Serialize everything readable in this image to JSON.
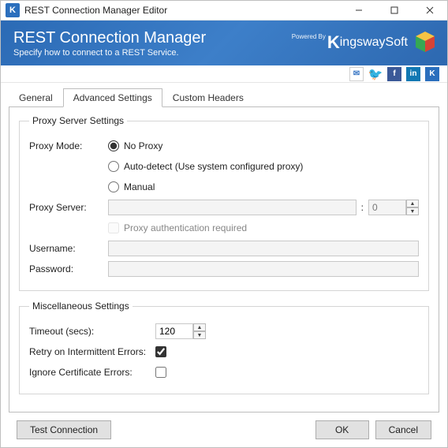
{
  "titlebar": {
    "title": "REST Connection Manager Editor"
  },
  "banner": {
    "heading": "REST Connection Manager",
    "sub": "Specify how to connect to a REST Service.",
    "powered": "Powered By",
    "brand1": "K",
    "brand2": "ingswaySoft"
  },
  "tabs": {
    "general": "General",
    "advanced": "Advanced Settings",
    "custom": "Custom Headers"
  },
  "proxy": {
    "legend": "Proxy Server Settings",
    "mode_label": "Proxy Mode:",
    "opt_no": "No Proxy",
    "opt_auto": "Auto-detect (Use system configured proxy)",
    "opt_manual": "Manual",
    "server_label": "Proxy Server:",
    "port_value": "0",
    "auth_label": "Proxy authentication required",
    "user_label": "Username:",
    "pass_label": "Password:"
  },
  "misc": {
    "legend": "Miscellaneous Settings",
    "timeout_label": "Timeout (secs):",
    "timeout_value": "120",
    "retry_label": "Retry on Intermittent Errors:",
    "ignore_label": "Ignore Certificate Errors:"
  },
  "footer": {
    "test": "Test Connection",
    "ok": "OK",
    "cancel": "Cancel"
  }
}
